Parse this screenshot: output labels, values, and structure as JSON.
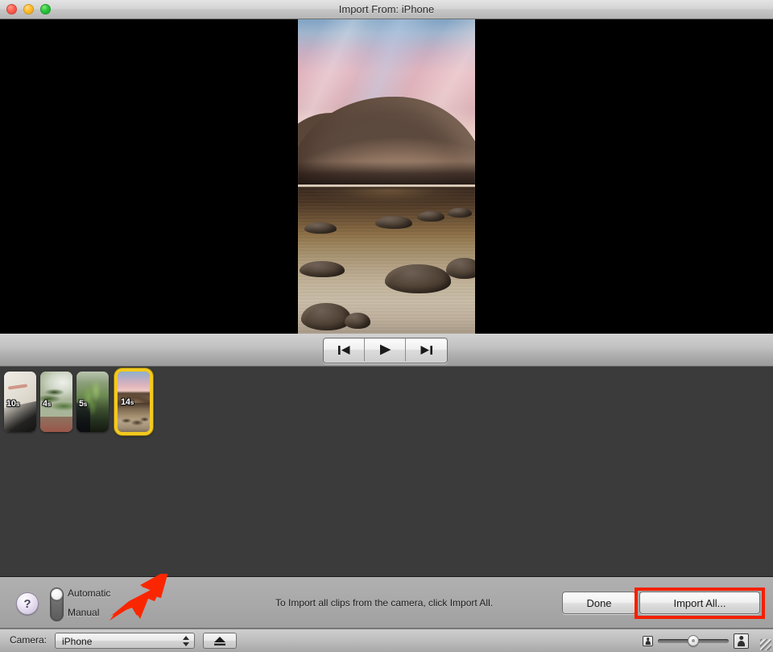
{
  "window": {
    "title": "Import From: iPhone",
    "traffic_lights": [
      {
        "name": "close",
        "color": "#ff5f52"
      },
      {
        "name": "minimize",
        "color": "#ffbd2e"
      },
      {
        "name": "zoom",
        "color": "#28c63a"
      }
    ]
  },
  "preview": {
    "background_color": "#000000",
    "photo_description": "Mountain at sunset reflected in a lake with rocks"
  },
  "transport": {
    "previous_icon": "skip-back-icon",
    "play_icon": "play-icon",
    "next_icon": "skip-forward-icon"
  },
  "browser": {
    "background_color": "#3b3b3b",
    "selected_index": 3,
    "selection_color": "#f3c91f",
    "clips": [
      {
        "duration": "10",
        "unit": "s",
        "texture": "tx-paper",
        "selected": false
      },
      {
        "duration": "4",
        "unit": "s",
        "texture": "tx-plant1",
        "selected": false
      },
      {
        "duration": "5",
        "unit": "s",
        "texture": "tx-plant2",
        "selected": false
      },
      {
        "duration": "14",
        "unit": "s",
        "texture": "tx-lake",
        "selected": true
      }
    ]
  },
  "controls": {
    "help_label": "?",
    "mode_switch": {
      "automatic_label": "Automatic",
      "manual_label": "Manual",
      "selected": "Automatic"
    },
    "status_text": "To Import all clips from the camera, click Import All.",
    "done_label": "Done",
    "import_all_label": "Import All...",
    "highlight_color": "#f42000"
  },
  "bottom": {
    "camera_label": "Camera:",
    "camera_value": "iPhone",
    "camera_options": [
      "iPhone"
    ],
    "eject_icon": "eject-icon",
    "zoom_small_icon": "person-small-icon",
    "zoom_large_icon": "person-large-icon",
    "resize_grip_icon": "resize-grip-icon"
  },
  "annotation": {
    "arrow_color": "#fa2600",
    "arrow_points_to": "mode-switch"
  }
}
